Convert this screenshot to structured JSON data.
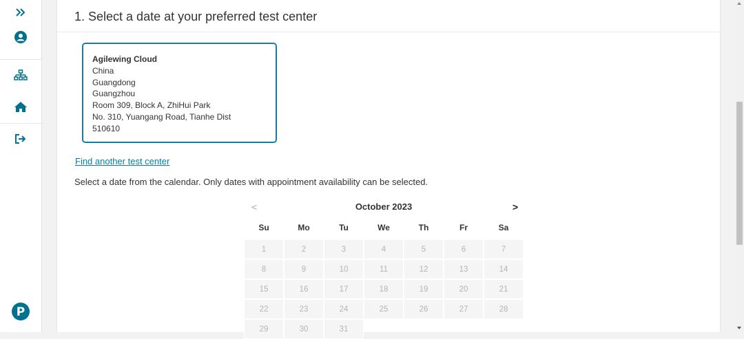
{
  "sidebar": {
    "icons": [
      "expand-icon",
      "user-icon",
      "sitemap-icon",
      "home-icon",
      "sign-out-icon",
      "pearson-logo-icon"
    ],
    "logo_letter": "P",
    "accent_color": "#00728f"
  },
  "step_title": "1. Select a date at your preferred test center",
  "test_center": {
    "name": "Agilewing Cloud",
    "address_lines": [
      "China",
      "Guangdong",
      "Guangzhou",
      "Room 309, Block A, ZhiHui Park",
      "No. 310, Yuangang Road, Tianhe Dist",
      "510610"
    ],
    "border_color": "#1a7aa0"
  },
  "find_link": "Find another test center",
  "instruction": "Select a date from the calendar. Only dates with appointment availability can be selected.",
  "calendar": {
    "prev": "<",
    "next": ">",
    "month": "October 2023",
    "weekdays": [
      "Su",
      "Mo",
      "Tu",
      "We",
      "Th",
      "Fr",
      "Sa"
    ],
    "days": [
      "1",
      "2",
      "3",
      "4",
      "5",
      "6",
      "7",
      "8",
      "9",
      "10",
      "11",
      "12",
      "13",
      "14",
      "15",
      "16",
      "17",
      "18",
      "19",
      "20",
      "21",
      "22",
      "23",
      "24",
      "25",
      "26",
      "27",
      "28",
      "29",
      "30",
      "31"
    ]
  }
}
